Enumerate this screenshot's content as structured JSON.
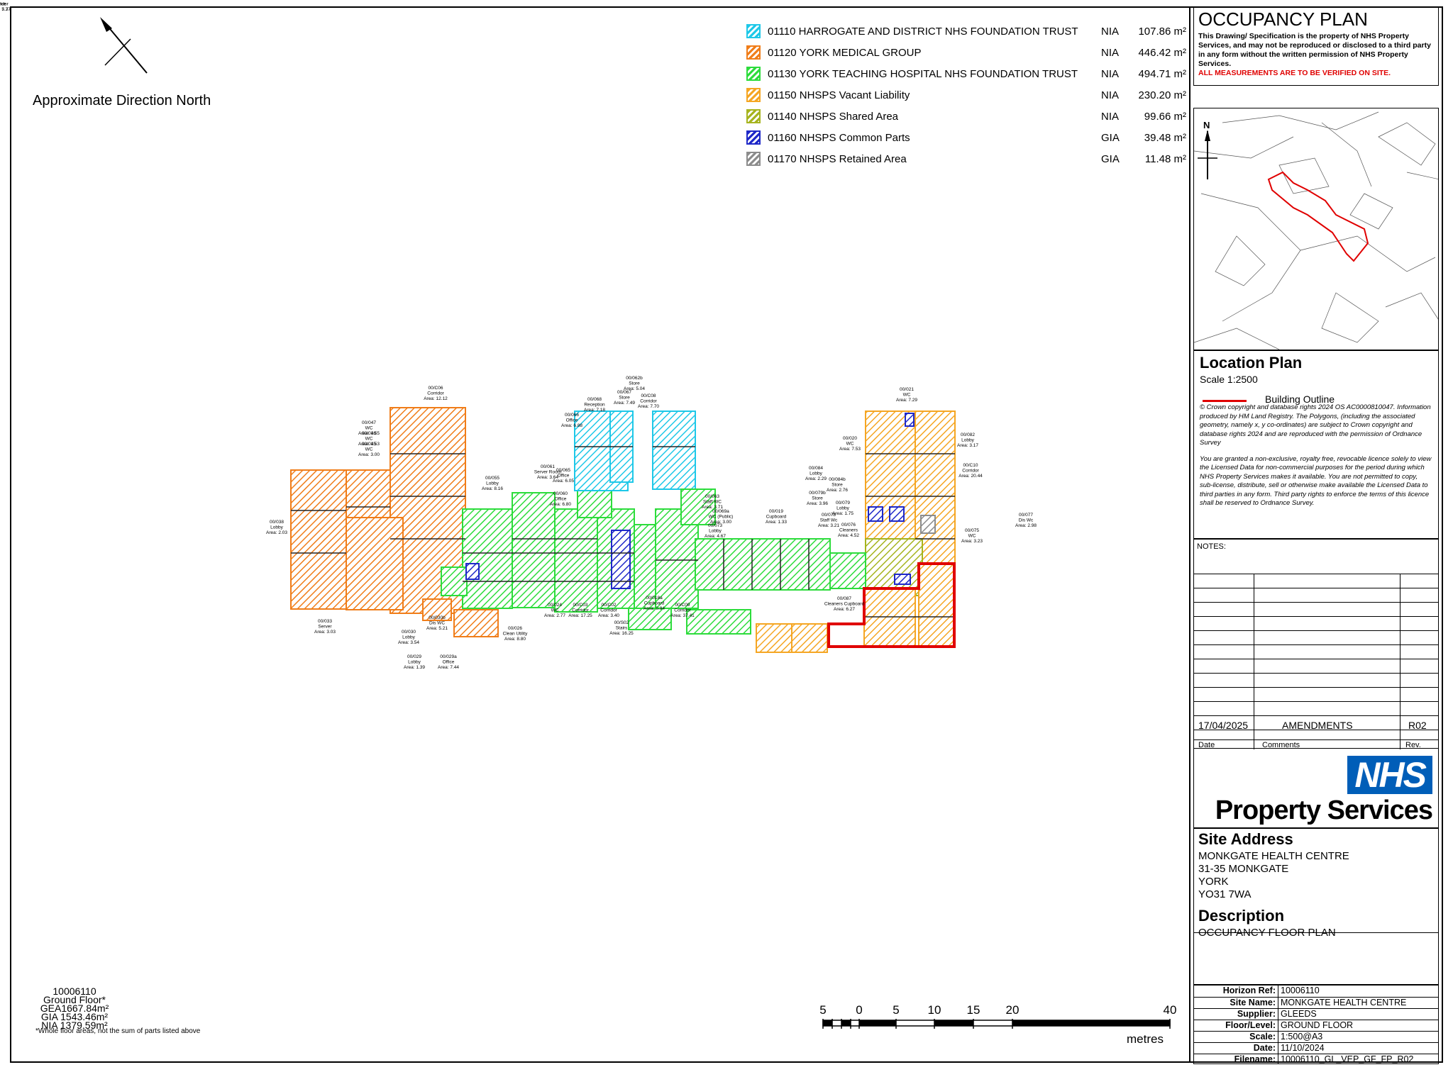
{
  "north": {
    "label": "Approximate Direction North"
  },
  "legend": [
    {
      "code": "01110",
      "name": "01110 HARROGATE AND DISTRICT NHS FOUNDATION TRUST",
      "type": "NIA",
      "area": "107.86 m²",
      "color": "#1ec8e8"
    },
    {
      "code": "01120",
      "name": "01120 YORK MEDICAL GROUP",
      "type": "NIA",
      "area": "446.42 m²",
      "color": "#f07d19"
    },
    {
      "code": "01130",
      "name": "01130 YORK TEACHING HOSPITAL NHS FOUNDATION TRUST",
      "type": "NIA",
      "area": "494.71 m²",
      "color": "#2ddc3c"
    },
    {
      "code": "01150",
      "name": "01150 NHSPS Vacant Liability",
      "type": "NIA",
      "area": "230.20 m²",
      "color": "#f5a623"
    },
    {
      "code": "01140",
      "name": "01140 NHSPS Shared Area",
      "type": "NIA",
      "area": "99.66 m²",
      "color": "#a6b41e"
    },
    {
      "code": "01160",
      "name": "01160 NHSPS Common Parts",
      "type": "GIA",
      "area": "39.48 m²",
      "color": "#1e28c8"
    },
    {
      "code": "01170",
      "name": "01170 NHSPS Retained Area",
      "type": "GIA",
      "area": "11.48 m²",
      "color": "#8c8c8c"
    }
  ],
  "title_block": {
    "title": "OCCUPANCY PLAN",
    "notice": "This Drawing/ Specification is the property of NHS Property Services, and may not be reproduced or disclosed to a third party in any form without the written permission of NHS Property Services.",
    "warning": "ALL MEASUREMENTS ARE TO BE VERIFIED ON SITE.",
    "location_title": "Location Plan",
    "location_scale": "Scale 1:2500",
    "building_outline": "Building Outline",
    "copyright1": "© Crown copyright and database rights 2024 OS AC0000810047. Information produced by HM Land Registry. The Polygons, (including the associated geometry, namely x, y co-ordinates) are subject to Crown copyright and database rights 2024 and are reproduced with the permission of Ordnance Survey",
    "copyright2": "You are granted a non-exclusive, royalty free, revocable licence solely to view the Licensed Data for non-commercial purposes for the period during which NHS Property Services makes it available. You are not permitted to copy, sub-license, distribute, sell or otherwise make available the Licensed Data to third parties in any form. Third party rights to enforce the terms of this licence shall be reserved to Ordnance Survey.",
    "notes_label": "NOTES:",
    "amend_date": "17/04/2025",
    "amend_comment": "AMENDMENTS",
    "amend_rev": "R02",
    "col_date": "Date",
    "col_comments": "Comments",
    "col_rev": "Rev.",
    "nhs": "NHS",
    "property_services": "Property Services",
    "site_address_h": "Site Address",
    "address": [
      "MONKGATE HEALTH CENTRE",
      "31-35 MONKGATE",
      "YORK",
      "YO31 7WA"
    ],
    "description_h": "Description",
    "description": "OCCUPANCY FLOOR PLAN",
    "info": [
      {
        "k": "Horizon Ref:",
        "v": "10006110"
      },
      {
        "k": "Site Name:",
        "v": "MONKGATE HEALTH CENTRE"
      },
      {
        "k": "Supplier:",
        "v": "GLEEDS"
      },
      {
        "k": "Floor/Level:",
        "v": "GROUND FLOOR"
      },
      {
        "k": "Scale:",
        "v": "1:500@A3"
      },
      {
        "k": "Date:",
        "v": "11/10/2024"
      },
      {
        "k": "Filename:",
        "v": "10006110_GL_VEP_GF_FP_R02"
      }
    ]
  },
  "floor_stats": {
    "ref": "10006110",
    "floor": "Ground Floor*",
    "gea": "GEA1667.84m²",
    "gia": "GIA 1543.46m²",
    "nia": "NIA 1379.59m²",
    "note": "*Whole floor areas, not the sum of parts listed above"
  },
  "scalebar": {
    "labels": [
      "5",
      "0",
      "5",
      "10",
      "15",
      "20",
      "40"
    ],
    "unit": "metres"
  },
  "rooms": [
    {
      "id": "00/C06",
      "name": "Corridor",
      "area": "Area: 12.12",
      "c": 1
    },
    {
      "id": "00/047",
      "name": "WC",
      "area": "Area: 1.55",
      "c": 1
    },
    {
      "id": "00/046",
      "name": "WC",
      "area": "Area: 1.53",
      "c": 1
    },
    {
      "id": "00/045",
      "name": "WC",
      "area": "Area: 3.00",
      "c": 1
    },
    {
      "id": "00/038",
      "name": "Lobby",
      "area": "Area: 2.03",
      "c": 1
    },
    {
      "id": "00/033",
      "name": "Server",
      "area": "Area: 3.03",
      "c": 1
    },
    {
      "id": "00/030",
      "name": "Lobby",
      "area": "Area: 3.54",
      "c": 1
    },
    {
      "id": "00/030b",
      "name": "Dis WC",
      "area": "Area: 5.21",
      "c": 1
    },
    {
      "id": "00/029",
      "name": "Lobby",
      "area": "Area: 1.39",
      "c": 1
    },
    {
      "id": "00/029a",
      "name": "Office",
      "area": "Area: 7.44",
      "c": 1
    },
    {
      "id": "00/055",
      "name": "Lobby",
      "area": "Area: 8.16",
      "c": 2
    },
    {
      "id": "00/026",
      "name": "Clean Utility",
      "area": "Area: 8.80",
      "c": 2
    },
    {
      "id": "00/061",
      "name": "Server Room",
      "area": "Area: 3.64",
      "c": 2
    },
    {
      "id": "00/060",
      "name": "Office",
      "area": "Area: 6.80",
      "c": 2
    },
    {
      "id": "00/024",
      "name": "WC",
      "area": "Area: 2.77",
      "c": 2
    },
    {
      "id": "00/C03",
      "name": "Corridor",
      "area": "Area: 17.25",
      "c": 2
    },
    {
      "id": "00/C02",
      "name": "Corridor",
      "area": "Area: 3.40",
      "c": 2
    },
    {
      "id": "00/S02",
      "name": "Stairs",
      "area": "Area: 16.25",
      "c": 5
    },
    {
      "id": "00/062b",
      "name": "Store",
      "area": "Area: 5.04",
      "c": 0
    },
    {
      "id": "00/068",
      "name": "Reception",
      "area": "Area: 7.18",
      "c": 0
    },
    {
      "id": "00/067",
      "name": "Store",
      "area": "Area: 7.49",
      "c": 0
    },
    {
      "id": "00/C08",
      "name": "Corridor",
      "area": "Area: 7.70",
      "c": 0
    },
    {
      "id": "00/066",
      "name": "Office",
      "area": "Area: 6.88",
      "c": 0
    },
    {
      "id": "00/065",
      "name": "Office",
      "area": "Area: 6.05",
      "c": 0
    },
    {
      "id": "00/063",
      "name": "Staff WC",
      "area": "Area: 3.71",
      "c": 0
    },
    {
      "id": "00/069a",
      "name": "WC (Public)",
      "area": "Area: 3.00",
      "c": 0
    },
    {
      "id": "00/073",
      "name": "Lobby",
      "area": "Area: 4.67",
      "c": 2
    },
    {
      "id": "00/019",
      "name": "Cupboard",
      "area": "Area: 1.33",
      "c": 2
    },
    {
      "id": "00/018a",
      "name": "Cupboard",
      "area": "Area: 0.94",
      "c": 2
    },
    {
      "id": "00/C09",
      "name": "Corridor",
      "area": "Area: 37.41",
      "c": 2
    },
    {
      "id": "00/021",
      "name": "WC",
      "area": "Area: 7.29",
      "c": 2
    },
    {
      "id": "00/020",
      "name": "WC",
      "area": "Area: 7.53",
      "c": 2
    },
    {
      "id": "00/082",
      "name": "Lobby",
      "area": "Area: 3.17",
      "c": 3
    },
    {
      "id": "00/C10",
      "name": "Corridor",
      "area": "Area: 20.44",
      "c": 3
    },
    {
      "id": "00/084",
      "name": "Lobby",
      "area": "Area: 2.29",
      "c": 3
    },
    {
      "id": "00/084b",
      "name": "Store",
      "area": "Area: 2.76",
      "c": 3
    },
    {
      "id": "00/079b",
      "name": "Store",
      "area": "Area: 3.96",
      "c": 3
    },
    {
      "id": "00/079",
      "name": "Lobby",
      "area": "Area: 1.75",
      "c": 3
    },
    {
      "id": "00/078",
      "name": "Staff Wc",
      "area": "Area: 3.21",
      "c": 3
    },
    {
      "id": "00/076",
      "name": "Cleaners",
      "area": "Area: 4.52",
      "c": 3
    },
    {
      "id": "00/077",
      "name": "Dis Wc",
      "area": "Area: 2.98",
      "c": 3
    },
    {
      "id": "00/075",
      "name": "WC",
      "area": "Area: 3.23",
      "c": 3
    },
    {
      "id": "00/087",
      "name": "Cleaners Cupboard",
      "area": "Area: 6.27",
      "c": 6
    },
    {
      "id": "00/088",
      "name": "Office",
      "area": "Area: 5.77",
      "c": 3
    },
    {
      "id": "00/C01",
      "name": "Corridor",
      "area": "Area: 7.37",
      "c": 3
    }
  ]
}
